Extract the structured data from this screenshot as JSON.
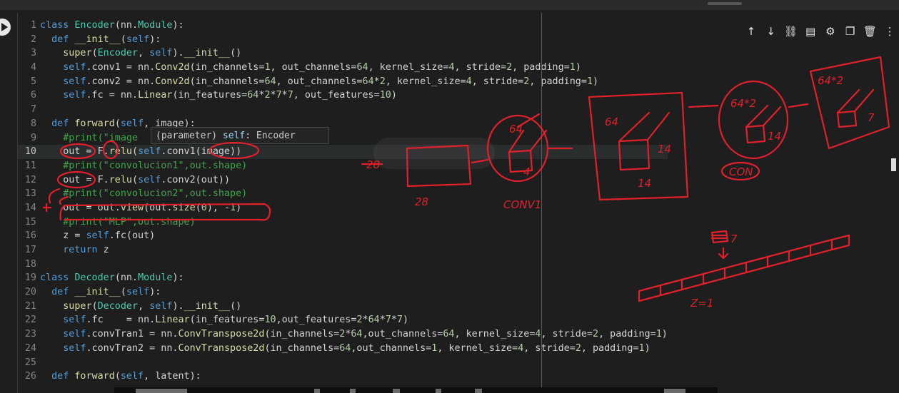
{
  "toolbar": {
    "items": [
      {
        "icon": "arrow-up-icon",
        "glyph": "↑"
      },
      {
        "icon": "arrow-down-icon",
        "glyph": "↓"
      },
      {
        "icon": "link-icon",
        "glyph": "⛓"
      },
      {
        "icon": "comment-icon",
        "glyph": "▤"
      },
      {
        "icon": "gear-icon",
        "glyph": "⚙"
      },
      {
        "icon": "copy-icon",
        "glyph": "❐"
      },
      {
        "icon": "delete-icon",
        "glyph": "🗑"
      },
      {
        "icon": "more-icon",
        "glyph": "⋮"
      }
    ]
  },
  "editor": {
    "current_line": 10,
    "lines": [
      {
        "n": "1",
        "t": "class Encoder(nn.Module):"
      },
      {
        "n": "2",
        "t": "  def __init__(self):"
      },
      {
        "n": "3",
        "t": "    super(Encoder, self).__init__()"
      },
      {
        "n": "4",
        "t": "    self.conv1 = nn.Conv2d(in_channels=1, out_channels=64, kernel_size=4, stride=2, padding=1)"
      },
      {
        "n": "5",
        "t": "    self.conv2 = nn.Conv2d(in_channels=64, out_channels=64*2, kernel_size=4, stride=2, padding=1)"
      },
      {
        "n": "6",
        "t": "    self.fc = nn.Linear(in_features=64*2*7*7, out_features=10)"
      },
      {
        "n": "7",
        "t": ""
      },
      {
        "n": "8",
        "t": "  def forward(self, image):"
      },
      {
        "n": "9",
        "t": "    #print(\"image"
      },
      {
        "n": "10",
        "t": "    out = F.relu(self.conv1(image))"
      },
      {
        "n": "11",
        "t": "    #print(\"convolucion1\",out.shape)"
      },
      {
        "n": "12",
        "t": "    out = F.relu(self.conv2(out))"
      },
      {
        "n": "13",
        "t": "    #print(\"convolucion2\",out.shape)"
      },
      {
        "n": "14",
        "t": "    out = out.view(out.size(0), -1)"
      },
      {
        "n": "15",
        "t": "    #print(\"MLP\",out.shape)"
      },
      {
        "n": "16",
        "t": "    z = self.fc(out)"
      },
      {
        "n": "17",
        "t": "    return z"
      },
      {
        "n": "18",
        "t": ""
      },
      {
        "n": "19",
        "t": "class Decoder(nn.Module):"
      },
      {
        "n": "20",
        "t": "  def __init__(self):"
      },
      {
        "n": "21",
        "t": "    super(Decoder, self).__init__()"
      },
      {
        "n": "22",
        "t": "    self.fc    = nn.Linear(in_features=10,out_features=2*64*7*7)"
      },
      {
        "n": "23",
        "t": "    self.convTran1 = nn.ConvTranspose2d(in_channels=2*64,out_channels=64, kernel_size=4, stride=2, padding=1)"
      },
      {
        "n": "24",
        "t": "    self.convTran2 = nn.ConvTranspose2d(in_channels=64,out_channels=1, kernel_size=4, stride=2, padding=1)"
      },
      {
        "n": "25",
        "t": ""
      },
      {
        "n": "26",
        "t": "  def forward(self, latent):"
      }
    ]
  },
  "tooltip": {
    "prefix": "(parameter) ",
    "name": "self",
    "suffix": ": Encoder"
  },
  "annotations": [
    "28",
    "28",
    "64",
    "4",
    "CONV1",
    "64",
    "14",
    "14",
    "64*2",
    "14",
    "CON",
    "64*2",
    "7",
    "7",
    "Z=1",
    "-7"
  ],
  "colors": {
    "ink": "#e0202a",
    "background": "#1e1e1e"
  }
}
